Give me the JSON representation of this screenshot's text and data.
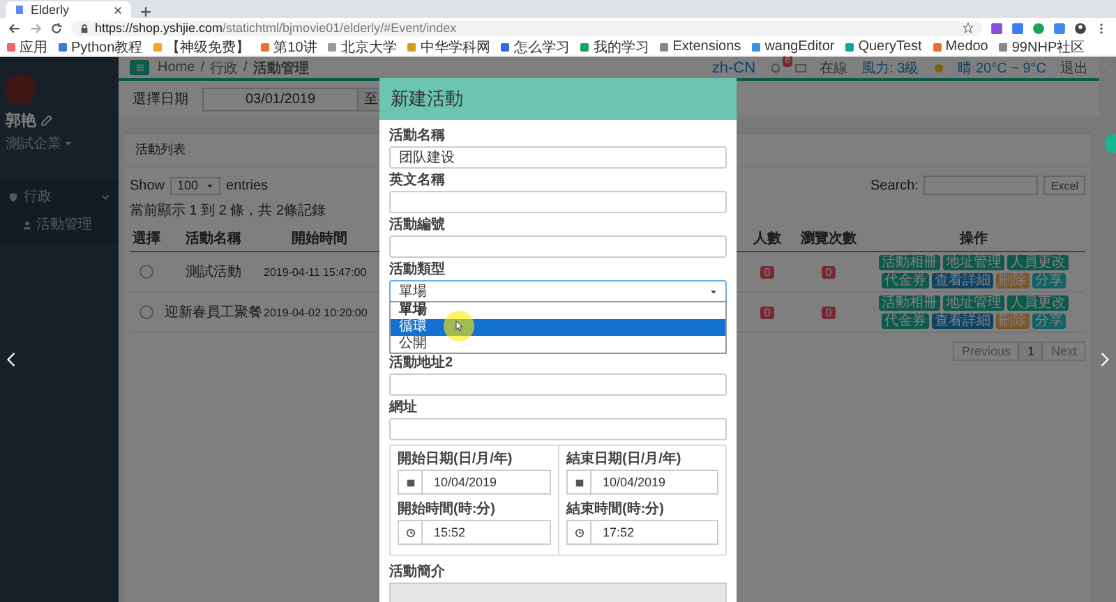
{
  "browser": {
    "tab_title": "Elderly",
    "url_host": "https://shop.yshjie.com",
    "url_path": "/statichtml/bjmovie01/elderly/#Event/index",
    "bookmarks": [
      "应用",
      "Python教程",
      "【神级免费】",
      "第10讲",
      "北京大学",
      "中华学科网",
      "怎么学习",
      "我的学习",
      "Extensions",
      "wangEditor",
      "QueryTest",
      "Medoo",
      "99NHP社区"
    ]
  },
  "sidebar": {
    "user_name": "郭艳",
    "company": "測試企業",
    "menu": [
      {
        "label": "行政",
        "expanded": true,
        "children": [
          {
            "label": "活動管理"
          }
        ]
      }
    ]
  },
  "topbar": {
    "breadcrumb": [
      "Home",
      "行政",
      "活動管理"
    ],
    "breadcrumb_separator": "/",
    "locale": "zh-CN",
    "notification_count": "8",
    "status": "在線",
    "wind": "風力: 3級",
    "weather": "晴 20°C ~ 9°C",
    "logout": "退出"
  },
  "filter": {
    "label": "選擇日期",
    "start_date": "03/01/2019",
    "separator": "至"
  },
  "panel": {
    "title": "活動列表",
    "show_label": "Show",
    "page_length": "100",
    "entries_label": "entries",
    "search_label": "Search:",
    "export_button": "Excel",
    "info": "當前顯示 1 到 2 條，共 2條記錄",
    "columns": [
      "選擇",
      "活動名稱",
      "開始時間",
      "人數",
      "瀏覽次數",
      "操作"
    ],
    "rows": [
      {
        "selected": false,
        "name": "測試活動",
        "start": "2019-04-11 15:47:00",
        "count": "0",
        "views": "0",
        "actions": [
          {
            "label": "活動相冊",
            "kind": "success"
          },
          {
            "label": "地址管理",
            "kind": "success"
          },
          {
            "label": "人員更改",
            "kind": "success"
          },
          {
            "label": "代金券",
            "kind": "success"
          },
          {
            "label": "查看詳細",
            "kind": "primary"
          },
          {
            "label": "刪除",
            "kind": "warning"
          },
          {
            "label": "分享",
            "kind": "info"
          }
        ]
      },
      {
        "selected": false,
        "name": "迎新春員工聚餐",
        "start": "2019-04-02 10:20:00",
        "count": "0",
        "views": "0",
        "actions": [
          {
            "label": "活動相冊",
            "kind": "success"
          },
          {
            "label": "地址管理",
            "kind": "success"
          },
          {
            "label": "人員更改",
            "kind": "success"
          },
          {
            "label": "代金券",
            "kind": "success"
          },
          {
            "label": "查看詳細",
            "kind": "primary"
          },
          {
            "label": "刪除",
            "kind": "warning"
          },
          {
            "label": "分享",
            "kind": "info"
          }
        ]
      }
    ],
    "pagination": [
      {
        "label": "Previous",
        "selected": false
      },
      {
        "label": "1",
        "selected": true
      },
      {
        "label": "Next",
        "selected": false
      }
    ]
  },
  "modal": {
    "title": "新建活動",
    "fields": [
      {
        "label": "活動名稱",
        "value": "团队建设"
      },
      {
        "label": "英文名稱"
      },
      {
        "label": "活動編號"
      }
    ],
    "type_field": {
      "label": "活動類型",
      "value": "單場",
      "expanded": true,
      "options": [
        {
          "label": "單場",
          "selected": true,
          "highlighted": false
        },
        {
          "label": "循環",
          "selected": false,
          "highlighted": true
        },
        {
          "label": "公開",
          "selected": false,
          "highlighted": false
        }
      ]
    },
    "fields_after": [
      {
        "label": "活動地址2"
      },
      {
        "label": "網址"
      }
    ],
    "schedule": [
      {
        "date_label": "開始日期(日/月/年)",
        "date": "10/04/2019",
        "time_label": "開始時間(時:分)",
        "time": "15:52"
      },
      {
        "date_label": "結束日期(日/月/年)",
        "date": "10/04/2019",
        "time_label": "結束時間(時:分)",
        "time": "17:52"
      }
    ],
    "description_label": "活動簡介"
  }
}
